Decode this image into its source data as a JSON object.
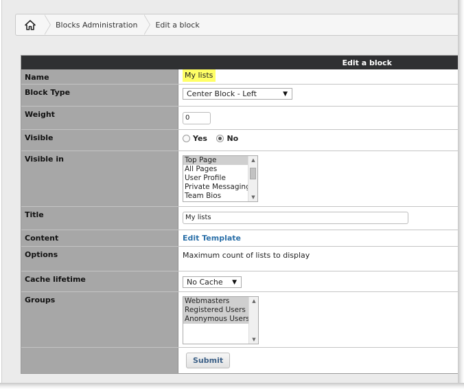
{
  "breadcrumb": {
    "home_icon": "home-icon",
    "items": [
      "Blocks Administration",
      "Edit a block"
    ]
  },
  "form": {
    "header": "Edit a block",
    "name": {
      "label": "Name",
      "value": "My lists"
    },
    "block_type": {
      "label": "Block Type",
      "value": "Center Block - Left"
    },
    "weight": {
      "label": "Weight",
      "value": "0"
    },
    "visible": {
      "label": "Visible",
      "options": [
        "Yes",
        "No"
      ],
      "selected": "No"
    },
    "visible_in": {
      "label": "Visible in",
      "options": [
        "Top Page",
        "All Pages",
        "User Profile",
        "Private Messaging",
        "Team Bios"
      ],
      "selected": [
        "Top Page"
      ]
    },
    "title": {
      "label": "Title",
      "value": "My lists"
    },
    "content": {
      "label": "Content",
      "link": "Edit Template"
    },
    "options": {
      "label": "Options",
      "text": "Maximum count of lists to display"
    },
    "cache_lifetime": {
      "label": "Cache lifetime",
      "value": "No Cache"
    },
    "groups": {
      "label": "Groups",
      "options": [
        "Webmasters",
        "Registered Users",
        "Anonymous Users"
      ],
      "selected": [
        "Webmasters",
        "Registered Users",
        "Anonymous Users"
      ]
    },
    "submit_label": "Submit"
  },
  "colors": {
    "header_bg": "#2f3032",
    "label_bg": "#a7a7a7",
    "highlight": "#ffff66",
    "link": "#2a6fa8"
  }
}
